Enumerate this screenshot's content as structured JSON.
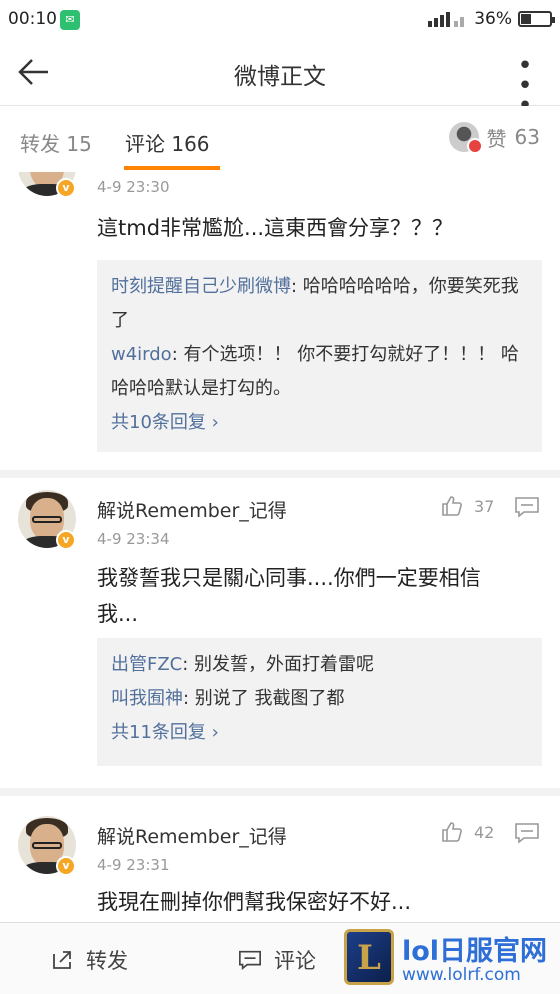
{
  "status_bar": {
    "time": "00:10",
    "battery": "36%",
    "battery_level": 0.36
  },
  "nav": {
    "title": "微博正文"
  },
  "tabs": {
    "repost_label": "转发",
    "repost_count": "15",
    "comment_label": "评论",
    "comment_count": "166",
    "like_label": "赞",
    "like_count": "63"
  },
  "comments": [
    {
      "time": "4-9 23:30",
      "text": "這tmd非常尷尬...這東西會分享？？？",
      "replies": [
        {
          "user": "时刻提醒自己少刷微博",
          "text": ": 哈哈哈哈哈哈，你要笑死我了"
        },
        {
          "user": "w4irdo",
          "text": ": 有个选项！！ 你不要打勾就好了！！！ 哈哈哈哈默认是打勾的。"
        }
      ],
      "more": "共10条回复 ›"
    },
    {
      "name": "解说Remember_记得",
      "time": "4-9 23:34",
      "likes": "37",
      "text": "我發誓我只是關心同事....你們一定要相信我...",
      "replies": [
        {
          "user": "出管FZC",
          "text": ": 别发誓，外面打着雷呢"
        },
        {
          "user": "叫我囿神",
          "text": ": 别说了 我截图了都"
        }
      ],
      "more": "共11条回复 ›"
    },
    {
      "name": "解说Remember_记得",
      "time": "4-9 23:31",
      "likes": "42",
      "text": "我現在刪掉你們幫我保密好不好..."
    }
  ],
  "bottom_bar": {
    "repost": "转发",
    "comment": "评论"
  },
  "watermark": {
    "logo_letter": "L",
    "title": "lol日服官网",
    "url": "www.lolrf.com"
  },
  "colors": {
    "accent": "#ff8200",
    "link": "#52709c",
    "watermark": "#2d6fd6"
  }
}
